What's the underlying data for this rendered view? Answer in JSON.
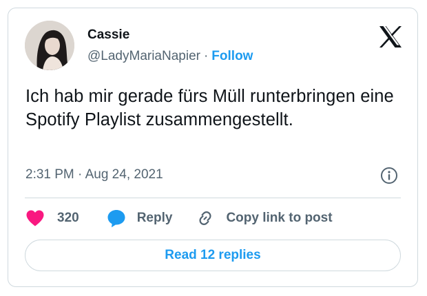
{
  "author": {
    "name": "Cassie",
    "handle": "@LadyMariaNapier",
    "separator": "·",
    "follow_label": "Follow"
  },
  "tweet": {
    "text": "Ich hab mir gerade fürs Müll runterbringen eine Spotify Playlist zusammengestellt.",
    "timestamp": "2:31 PM · Aug 24, 2021"
  },
  "actions": {
    "like_count": "320",
    "reply_label": "Reply",
    "copy_label": "Copy link to post"
  },
  "footer": {
    "read_replies_label": "Read 12 replies"
  },
  "icons": {
    "logo": "x-logo-icon",
    "info": "info-icon",
    "like": "heart-icon",
    "reply": "speech-bubble-icon",
    "copy": "link-icon"
  },
  "colors": {
    "accent": "#1d9bf0",
    "like": "#f91880",
    "text": "#0f1419",
    "muted": "#536471",
    "border": "#cfd9de"
  }
}
